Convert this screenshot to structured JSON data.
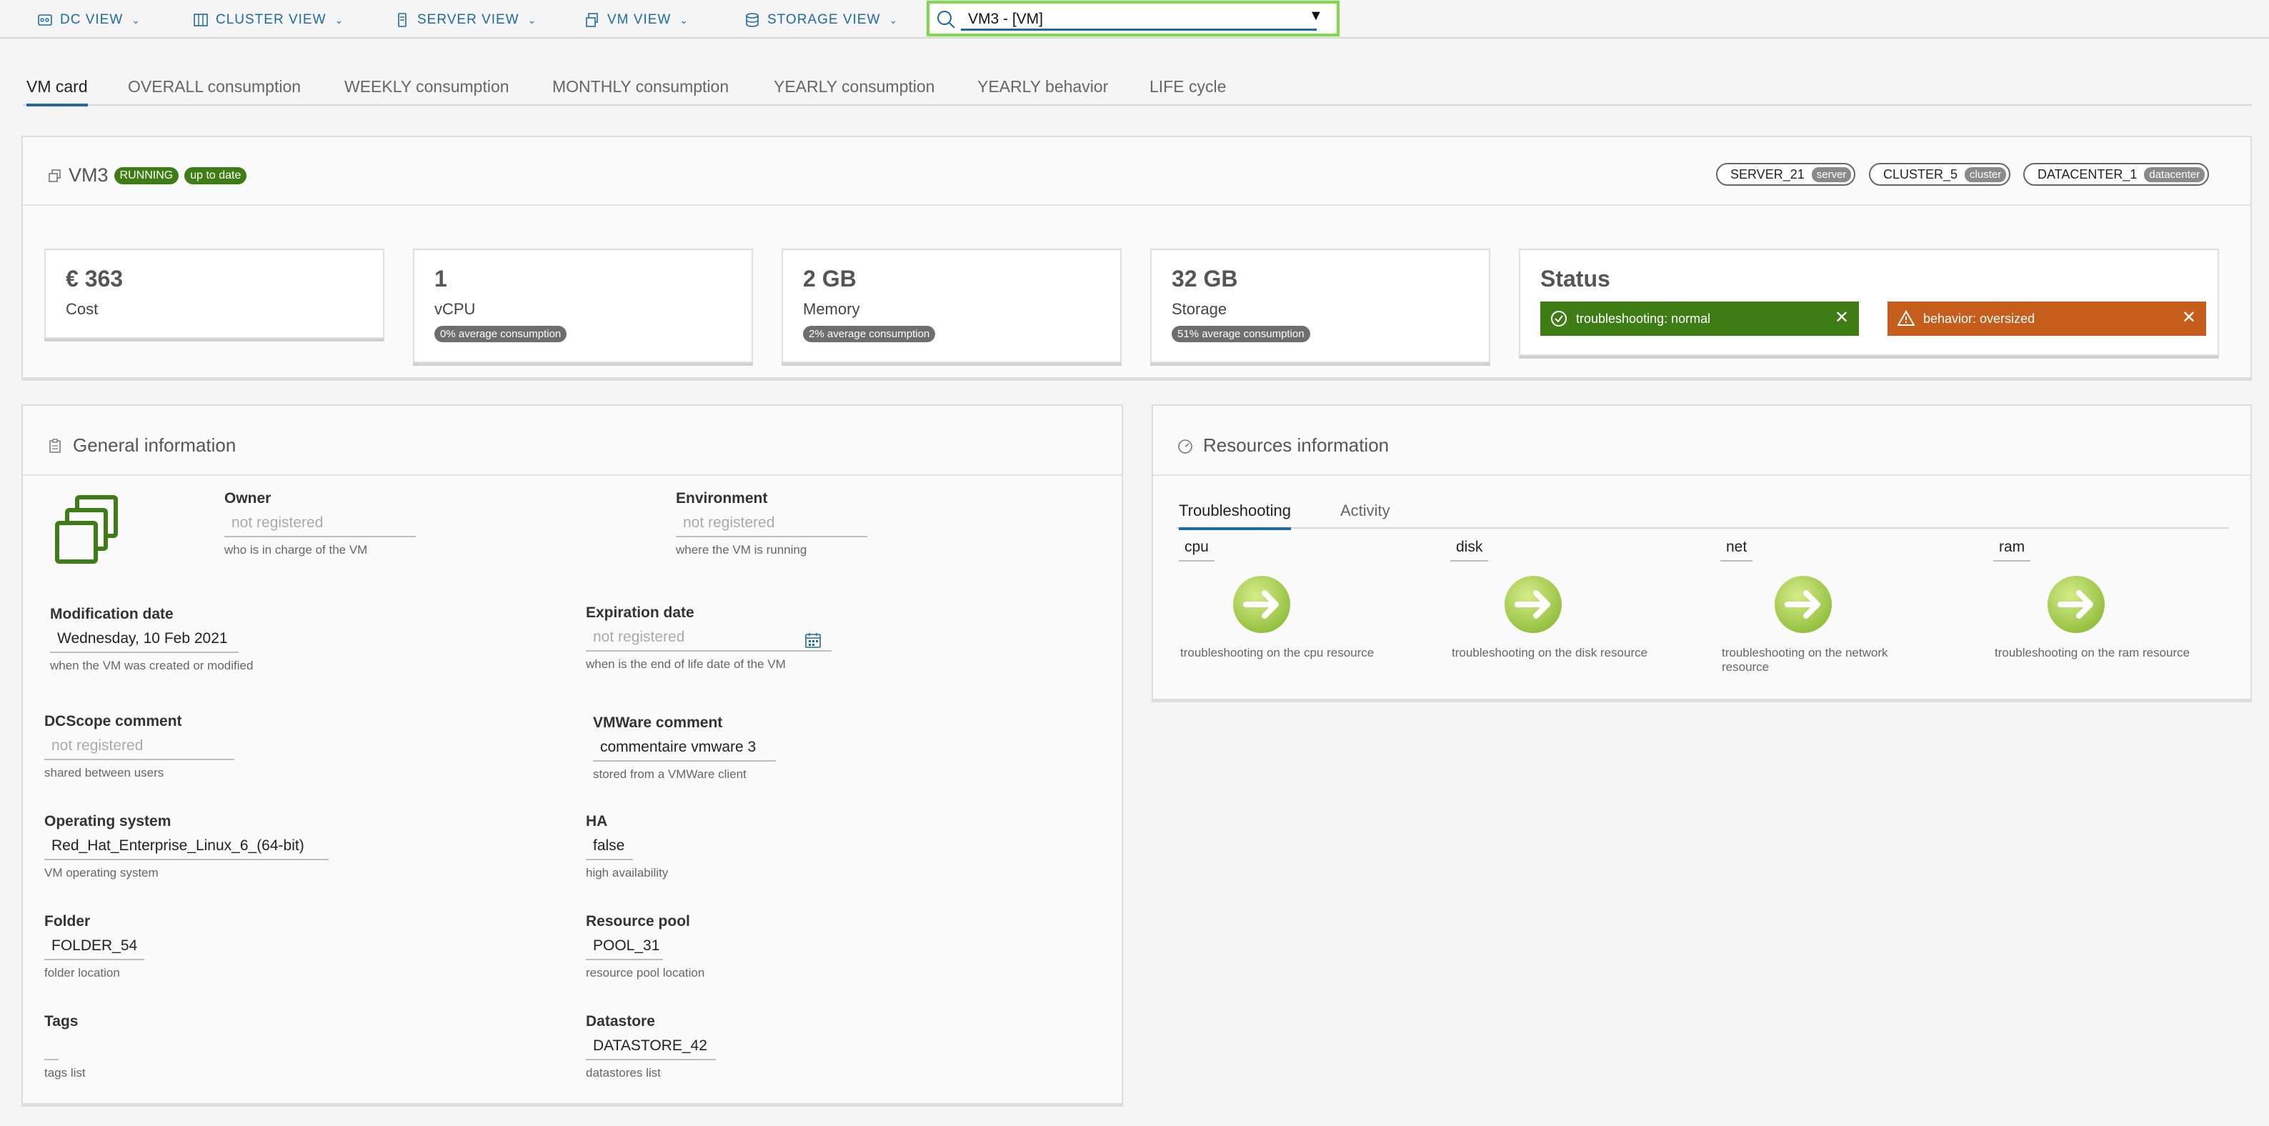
{
  "nav": {
    "dc_view": "DC VIEW",
    "cluster_view": "CLUSTER VIEW",
    "server_view": "SERVER VIEW",
    "vm_view": "VM VIEW",
    "storage_view": "STORAGE VIEW",
    "search_value": "VM3 - [VM]"
  },
  "tabs": [
    "VM card",
    "OVERALL consumption",
    "WEEKLY consumption",
    "MONTHLY consumption",
    "YEARLY consumption",
    "YEARLY behavior",
    "LIFE cycle"
  ],
  "vm": {
    "name": "VM3",
    "badge_running": "RUNNING",
    "badge_uptodate": "up to date",
    "relations": [
      {
        "name": "SERVER_21",
        "type": "server"
      },
      {
        "name": "CLUSTER_5",
        "type": "cluster"
      },
      {
        "name": "DATACENTER_1",
        "type": "datacenter"
      }
    ]
  },
  "cards": {
    "cost": {
      "value": "€ 363",
      "label": "Cost"
    },
    "vcpu": {
      "value": "1",
      "label": "vCPU",
      "badge": "0% average consumption"
    },
    "memory": {
      "value": "2 GB",
      "label": "Memory",
      "badge": "2% average consumption"
    },
    "storage": {
      "value": "32 GB",
      "label": "Storage",
      "badge": "51% average consumption"
    },
    "status": {
      "title": "Status",
      "msg1": "troubleshooting: normal",
      "msg2": "behavior: oversized"
    }
  },
  "colors": {
    "accent": "#1d6aa5",
    "green": "#3e7c16",
    "orange": "#c55d1c",
    "highlight": "#7ddb48"
  },
  "general": {
    "title": "General information",
    "owner": {
      "label": "Owner",
      "value": "not registered",
      "help": "who is in charge of the VM"
    },
    "environment": {
      "label": "Environment",
      "value": "not registered",
      "help": "where the VM is running"
    },
    "modification": {
      "label": "Modification date",
      "value": "Wednesday, 10 Feb 2021",
      "help": "when the VM was created or modified"
    },
    "expiration": {
      "label": "Expiration date",
      "value": "not registered",
      "help": "when is the end of life date of the VM"
    },
    "dcscope": {
      "label": "DCScope comment",
      "value": "not registered",
      "help": "shared between users"
    },
    "vmware": {
      "label": "VMWare comment",
      "value": "commentaire vmware 3",
      "help": "stored from a VMWare client"
    },
    "os": {
      "label": "Operating system",
      "value": "Red_Hat_Enterprise_Linux_6_(64-bit)",
      "help": "VM operating system"
    },
    "ha": {
      "label": "HA",
      "value": "false",
      "help": "high availability"
    },
    "folder": {
      "label": "Folder",
      "value": "FOLDER_54",
      "help": "folder location"
    },
    "pool": {
      "label": "Resource pool",
      "value": "POOL_31",
      "help": "resource pool location"
    },
    "tags": {
      "label": "Tags",
      "value": "",
      "help": "tags list"
    },
    "datastore": {
      "label": "Datastore",
      "value": "DATASTORE_42",
      "help": "datastores list"
    }
  },
  "resources": {
    "title": "Resources information",
    "tab1": "Troubleshooting",
    "tab2": "Activity",
    "items": [
      {
        "name": "cpu",
        "desc": "troubleshooting on the cpu resource"
      },
      {
        "name": "disk",
        "desc": "troubleshooting on the disk resource"
      },
      {
        "name": "net",
        "desc": "troubleshooting on the network resource"
      },
      {
        "name": "ram",
        "desc": "troubleshooting on the ram resource"
      }
    ]
  }
}
